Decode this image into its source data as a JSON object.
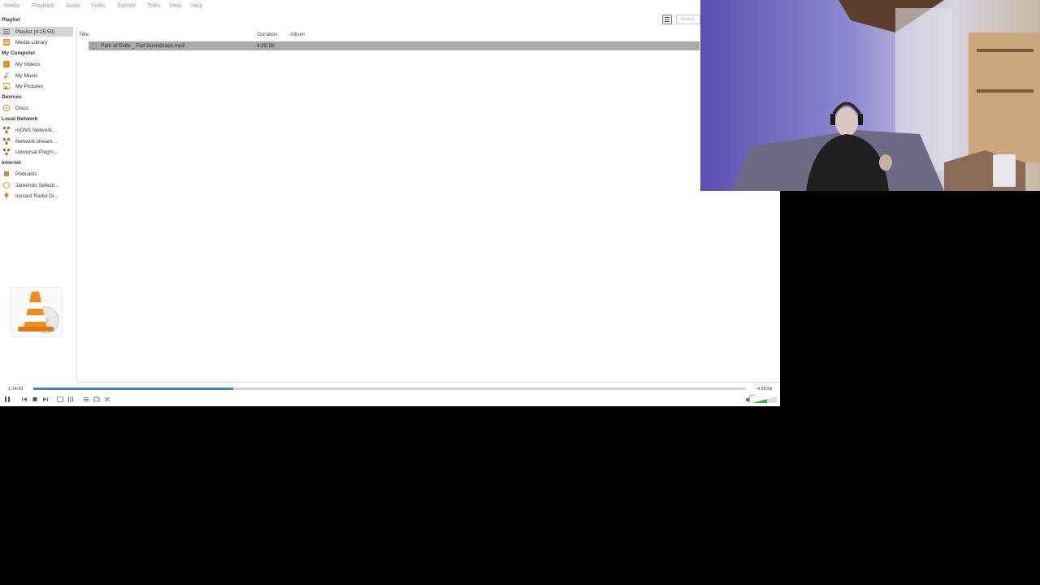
{
  "menu": [
    "Media",
    "Playback",
    "Audio",
    "Video",
    "Subtitle",
    "Tools",
    "View",
    "Help"
  ],
  "sidebar": {
    "playlist_header": "Playlist",
    "playlist_items": [
      {
        "label": "Playlist (4:25:59)",
        "icon": "playlist-icon"
      },
      {
        "label": "Media Library",
        "icon": "media-library-icon"
      }
    ],
    "my_computer_header": "My Computer",
    "my_computer_items": [
      {
        "label": "My Videos",
        "icon": "videos-icon"
      },
      {
        "label": "My Music",
        "icon": "music-note-icon"
      },
      {
        "label": "My Pictures",
        "icon": "pictures-icon"
      }
    ],
    "devices_header": "Devices",
    "devices_items": [
      {
        "label": "Discs",
        "icon": "disc-icon"
      }
    ],
    "local_network_header": "Local Network",
    "local_network_items": [
      {
        "label": "mDNS Network...",
        "icon": "network-icon"
      },
      {
        "label": "Network stream...",
        "icon": "network-icon"
      },
      {
        "label": "Universal Plug'n...",
        "icon": "network-icon"
      }
    ],
    "internet_header": "Internet",
    "internet_items": [
      {
        "label": "Podcasts",
        "icon": "podcast-icon"
      },
      {
        "label": "Jamendo Selecti...",
        "icon": "jamendo-icon"
      },
      {
        "label": "Icecast Radio Di...",
        "icon": "radio-icon"
      }
    ]
  },
  "playlist": {
    "columns": {
      "title": "Title",
      "duration": "Duration",
      "album": "Album"
    },
    "rows": [
      {
        "title": "Path of Exile _ Full Soundtrack.mp3",
        "duration": "4:25:59",
        "album": ""
      }
    ]
  },
  "search": {
    "placeholder": "Search"
  },
  "seek": {
    "elapsed": "1:14:43",
    "total": "4:25:59",
    "progress": 0.281
  },
  "volume": {
    "label": "60%",
    "level": 0.6
  },
  "colors": {
    "accent": "#3b86c6",
    "selected_row": "#a9a9a9",
    "sidebar_selected": "#d6d6d6"
  }
}
